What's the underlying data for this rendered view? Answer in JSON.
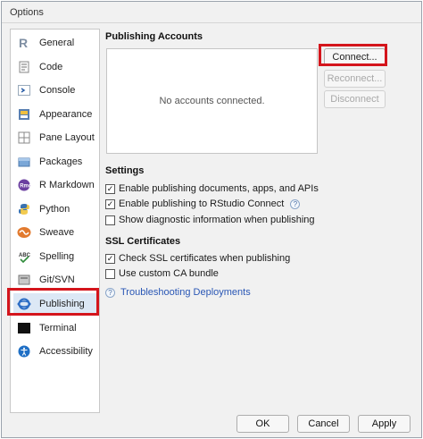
{
  "window": {
    "title": "Options"
  },
  "sidebar": {
    "items": [
      {
        "label": "General",
        "icon": "r-logo-icon"
      },
      {
        "label": "Code",
        "icon": "code-icon"
      },
      {
        "label": "Console",
        "icon": "console-icon"
      },
      {
        "label": "Appearance",
        "icon": "appearance-icon"
      },
      {
        "label": "Pane Layout",
        "icon": "pane-layout-icon"
      },
      {
        "label": "Packages",
        "icon": "packages-icon"
      },
      {
        "label": "R Markdown",
        "icon": "rmarkdown-icon"
      },
      {
        "label": "Python",
        "icon": "python-icon"
      },
      {
        "label": "Sweave",
        "icon": "sweave-icon"
      },
      {
        "label": "Spelling",
        "icon": "spelling-icon"
      },
      {
        "label": "Git/SVN",
        "icon": "git-icon"
      },
      {
        "label": "Publishing",
        "icon": "publishing-icon"
      },
      {
        "label": "Terminal",
        "icon": "terminal-icon"
      },
      {
        "label": "Accessibility",
        "icon": "accessibility-icon"
      }
    ],
    "selected": "Publishing"
  },
  "publishing": {
    "accounts_title": "Publishing Accounts",
    "no_accounts": "No accounts connected.",
    "connect_label": "Connect...",
    "reconnect_label": "Reconnect...",
    "disconnect_label": "Disconnect"
  },
  "settings": {
    "title": "Settings",
    "enable_publishing": "Enable publishing documents, apps, and APIs",
    "enable_rstudio_connect": "Enable publishing to RStudio Connect",
    "show_diagnostic": "Show diagnostic information when publishing"
  },
  "ssl": {
    "title": "SSL Certificates",
    "check_ssl": "Check SSL certificates when publishing",
    "custom_ca": "Use custom CA bundle"
  },
  "troubleshooting_link": "Troubleshooting Deployments",
  "footer": {
    "ok_label": "OK",
    "cancel_label": "Cancel",
    "apply_label": "Apply"
  },
  "colors": {
    "highlight": "#d4151c",
    "selected_bg": "#dce8f5",
    "link": "#2a57b5"
  }
}
